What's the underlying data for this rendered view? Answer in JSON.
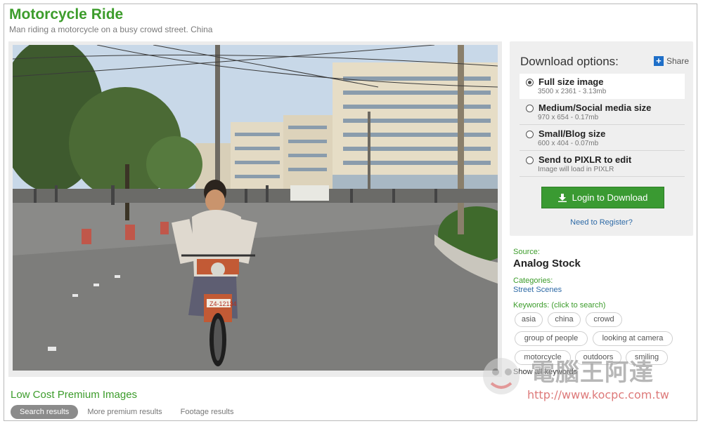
{
  "header": {
    "title": "Motorcycle Ride",
    "subtitle": "Man riding a motorcycle on a busy crowd street. China"
  },
  "photo": {
    "plate": "Z4-12134"
  },
  "download": {
    "title": "Download options:",
    "share_label": "Share",
    "options": [
      {
        "label": "Full size image",
        "sub": "3500 x 2361 - 3.13mb",
        "selected": true
      },
      {
        "label": "Medium/Social media size",
        "sub": "970 x 654 - 0.17mb",
        "selected": false
      },
      {
        "label": "Small/Blog size",
        "sub": "600 x 404 - 0.07mb",
        "selected": false
      },
      {
        "label": "Send to PIXLR to edit",
        "sub": "Image will load in PIXLR",
        "selected": false
      }
    ],
    "login_label": "Login to Download",
    "register_label": "Need to Register?"
  },
  "meta": {
    "source_label": "Source:",
    "source_value": "Analog Stock",
    "categories_label": "Categories:",
    "categories_value": "Street Scenes",
    "keywords_label": "Keywords: (click to search)",
    "keywords": [
      "asia",
      "china",
      "crowd",
      "group of people",
      "looking at camera",
      "motorcycle",
      "outdoors",
      "smiling"
    ],
    "show_all_label": "Show all keywords"
  },
  "bottom": {
    "heading": "Low Cost Premium Images",
    "tabs": [
      "Search results",
      "More premium results",
      "Footage results"
    ]
  },
  "watermark": {
    "text": "電腦王阿達",
    "url": "http://www.kocpc.com.tw"
  },
  "colors": {
    "accent_green": "#3c9c2b",
    "button_green": "#3a9a32",
    "link_blue": "#2e6aa6"
  }
}
